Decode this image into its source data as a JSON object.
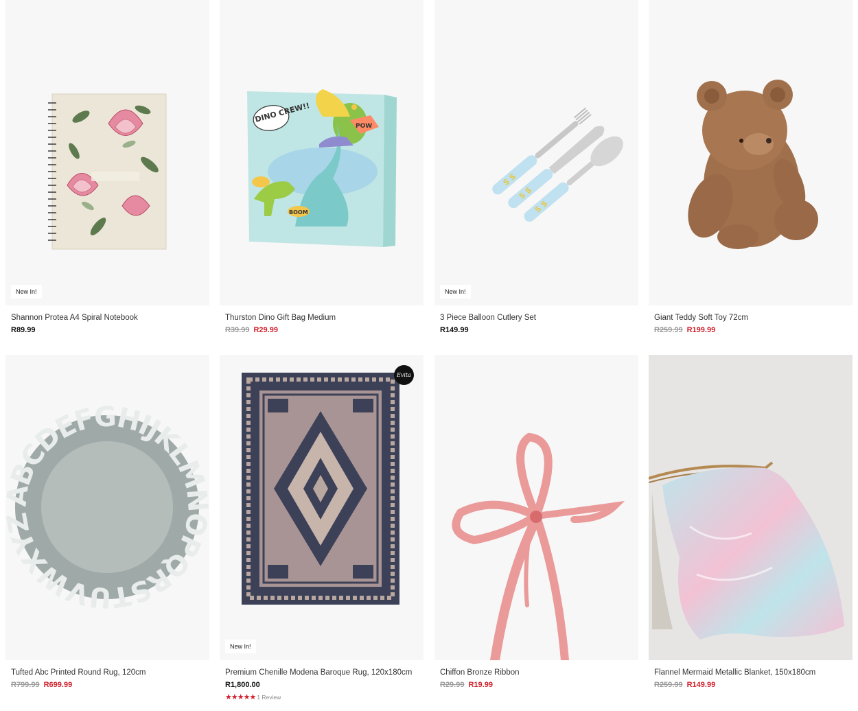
{
  "products": [
    {
      "name": "Shannon Protea A4 Spiral Notebook",
      "badge": "New In!",
      "price": "R89.99"
    },
    {
      "name": "Thurston Dino Gift Bag Medium",
      "old_price": "R39.99",
      "sale_price": "R29.99",
      "bag_text": {
        "speech": "DINO CREW!!",
        "pow": "POW",
        "boom": "BOOM"
      }
    },
    {
      "name": "3 Piece Balloon Cutlery Set",
      "badge": "New In!",
      "price": "R149.99"
    },
    {
      "name": "Giant Teddy Soft Toy 72cm",
      "old_price": "R259.99",
      "sale_price": "R199.99"
    },
    {
      "name": "Tufted Abc Printed Round Rug, 120cm",
      "old_price": "R799.99",
      "sale_price": "R699.99",
      "rug_letters": "ABCDEFGHIJKLMNOPQRSTUVWXYZ"
    },
    {
      "name": "Premium Chenille Modena Baroque Rug, 120x180cm",
      "badge": "New In!",
      "brand_logo": "Evita",
      "price": "R1,800.00",
      "stars": "★★★★★",
      "rating": 5,
      "reviews": "1 Review"
    },
    {
      "name": "Chiffon Bronze Ribbon",
      "old_price": "R29.99",
      "sale_price": "R19.99"
    },
    {
      "name": "Flannel Mermaid Metallic Blanket, 150x180cm",
      "old_price": "R259.99",
      "sale_price": "R149.99"
    }
  ],
  "colors": {
    "sale": "#d0202c",
    "strike": "#9a9a9a",
    "image_bg": "#f7f7f7"
  }
}
